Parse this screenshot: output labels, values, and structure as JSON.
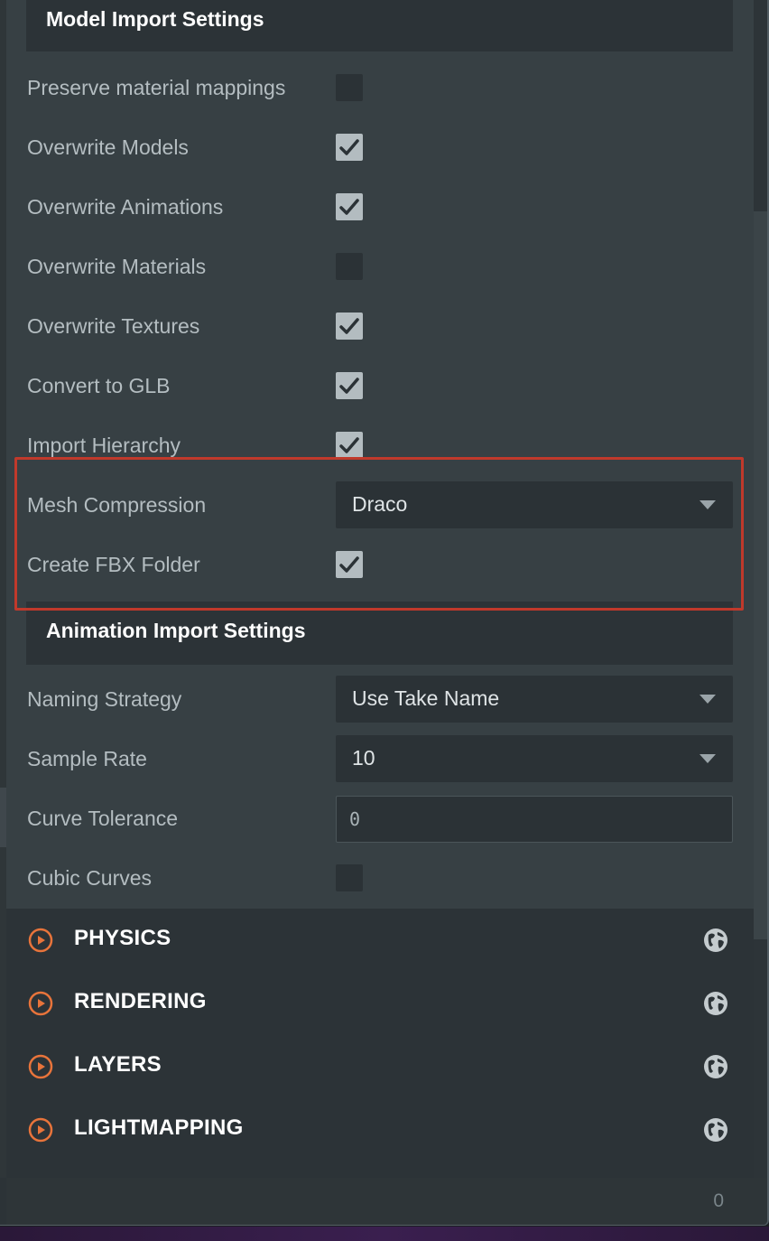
{
  "model_import": {
    "header": "Model Import Settings",
    "rows": [
      {
        "label": "Preserve material mappings",
        "checked": false
      },
      {
        "label": "Overwrite Models",
        "checked": true
      },
      {
        "label": "Overwrite Animations",
        "checked": true
      },
      {
        "label": "Overwrite Materials",
        "checked": false
      },
      {
        "label": "Overwrite Textures",
        "checked": true
      },
      {
        "label": "Convert to GLB",
        "checked": true
      },
      {
        "label": "Import Hierarchy",
        "checked": true
      }
    ],
    "mesh_compression": {
      "label": "Mesh Compression",
      "value": "Draco"
    },
    "create_fbx_folder": {
      "label": "Create FBX Folder",
      "checked": true
    }
  },
  "animation_import": {
    "header": "Animation Import Settings",
    "naming_strategy": {
      "label": "Naming Strategy",
      "value": "Use Take Name"
    },
    "sample_rate": {
      "label": "Sample Rate",
      "value": "10"
    },
    "curve_tolerance": {
      "label": "Curve Tolerance",
      "value": "0"
    },
    "cubic_curves": {
      "label": "Cubic Curves",
      "checked": false
    }
  },
  "sections": [
    {
      "title": "PHYSICS",
      "icon": "play-circle-icon",
      "right_icon": "globe-icon"
    },
    {
      "title": "RENDERING",
      "icon": "play-circle-icon",
      "right_icon": "globe-icon"
    },
    {
      "title": "LAYERS",
      "icon": "play-circle-icon",
      "right_icon": "globe-icon"
    },
    {
      "title": "LIGHTMAPPING",
      "icon": "play-circle-icon",
      "right_icon": "globe-icon"
    }
  ],
  "footer": {
    "count": "0"
  },
  "colors": {
    "accent": "#e8743b",
    "highlight": "#c0392b",
    "panel": "#374044",
    "header": "#2c3337"
  }
}
